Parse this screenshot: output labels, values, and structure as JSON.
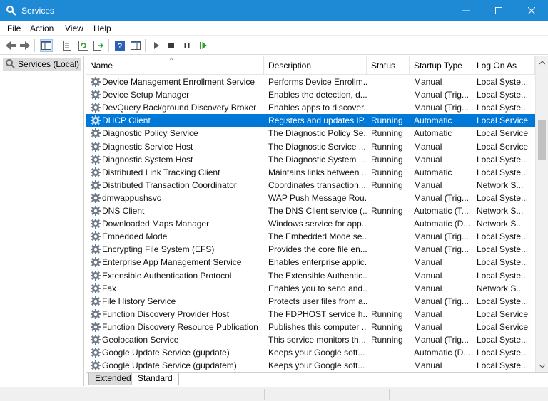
{
  "window": {
    "title": "Services"
  },
  "menu": [
    "File",
    "Action",
    "View",
    "Help"
  ],
  "toolbar": [
    "back-icon",
    "forward-icon",
    "show-hide-tree-icon",
    "properties-icon",
    "refresh-icon",
    "export-list-icon",
    "help-icon",
    "show-hide-action-pane-icon",
    "start-service-icon",
    "stop-service-icon",
    "pause-service-icon",
    "restart-service-icon"
  ],
  "tree": {
    "root_label": "Services (Local)"
  },
  "columns": [
    "Name",
    "Description",
    "Status",
    "Startup Type",
    "Log On As"
  ],
  "rows": [
    {
      "name": "Device Management Enrollment Service",
      "description": "Performs Device Enrollm...",
      "status": "",
      "startup": "Manual",
      "logon": "Local Syste..."
    },
    {
      "name": "Device Setup Manager",
      "description": "Enables the detection, d...",
      "status": "",
      "startup": "Manual (Trig...",
      "logon": "Local Syste..."
    },
    {
      "name": "DevQuery Background Discovery Broker",
      "description": "Enables apps to discover...",
      "status": "",
      "startup": "Manual (Trig...",
      "logon": "Local Syste..."
    },
    {
      "name": "DHCP Client",
      "description": "Registers and updates IP...",
      "status": "Running",
      "startup": "Automatic",
      "logon": "Local Service",
      "selected": true
    },
    {
      "name": "Diagnostic Policy Service",
      "description": "The Diagnostic Policy Se...",
      "status": "Running",
      "startup": "Automatic",
      "logon": "Local Service"
    },
    {
      "name": "Diagnostic Service Host",
      "description": "The Diagnostic Service ...",
      "status": "Running",
      "startup": "Manual",
      "logon": "Local Service"
    },
    {
      "name": "Diagnostic System Host",
      "description": "The Diagnostic System ...",
      "status": "Running",
      "startup": "Manual",
      "logon": "Local Syste..."
    },
    {
      "name": "Distributed Link Tracking Client",
      "description": "Maintains links between ...",
      "status": "Running",
      "startup": "Automatic",
      "logon": "Local Syste..."
    },
    {
      "name": "Distributed Transaction Coordinator",
      "description": "Coordinates transaction...",
      "status": "Running",
      "startup": "Manual",
      "logon": "Network S..."
    },
    {
      "name": "dmwappushsvc",
      "description": "WAP Push Message Rou...",
      "status": "",
      "startup": "Manual (Trig...",
      "logon": "Local Syste..."
    },
    {
      "name": "DNS Client",
      "description": "The DNS Client service (...",
      "status": "Running",
      "startup": "Automatic (T...",
      "logon": "Network S..."
    },
    {
      "name": "Downloaded Maps Manager",
      "description": "Windows service for app...",
      "status": "",
      "startup": "Automatic (D...",
      "logon": "Network S..."
    },
    {
      "name": "Embedded Mode",
      "description": "The Embedded Mode se...",
      "status": "",
      "startup": "Manual (Trig...",
      "logon": "Local Syste..."
    },
    {
      "name": "Encrypting File System (EFS)",
      "description": "Provides the core file en...",
      "status": "",
      "startup": "Manual (Trig...",
      "logon": "Local Syste..."
    },
    {
      "name": "Enterprise App Management Service",
      "description": "Enables enterprise applic...",
      "status": "",
      "startup": "Manual",
      "logon": "Local Syste..."
    },
    {
      "name": "Extensible Authentication Protocol",
      "description": "The Extensible Authentic...",
      "status": "",
      "startup": "Manual",
      "logon": "Local Syste..."
    },
    {
      "name": "Fax",
      "description": "Enables you to send and...",
      "status": "",
      "startup": "Manual",
      "logon": "Network S..."
    },
    {
      "name": "File History Service",
      "description": "Protects user files from a...",
      "status": "",
      "startup": "Manual (Trig...",
      "logon": "Local Syste..."
    },
    {
      "name": "Function Discovery Provider Host",
      "description": "The FDPHOST service h...",
      "status": "Running",
      "startup": "Manual",
      "logon": "Local Service"
    },
    {
      "name": "Function Discovery Resource Publication",
      "description": "Publishes this computer ...",
      "status": "Running",
      "startup": "Manual",
      "logon": "Local Service"
    },
    {
      "name": "Geolocation Service",
      "description": "This service monitors th...",
      "status": "Running",
      "startup": "Manual (Trig...",
      "logon": "Local Syste..."
    },
    {
      "name": "Google Update Service (gupdate)",
      "description": "Keeps your Google soft...",
      "status": "",
      "startup": "Automatic (D...",
      "logon": "Local Syste..."
    },
    {
      "name": "Google Update Service (gupdatem)",
      "description": "Keeps your Google soft...",
      "status": "",
      "startup": "Manual",
      "logon": "Local Syste..."
    }
  ],
  "tabs": [
    "Extended",
    "Standard"
  ],
  "colors": {
    "titlebar": "#1e8ad6",
    "selection": "#0078d7"
  }
}
